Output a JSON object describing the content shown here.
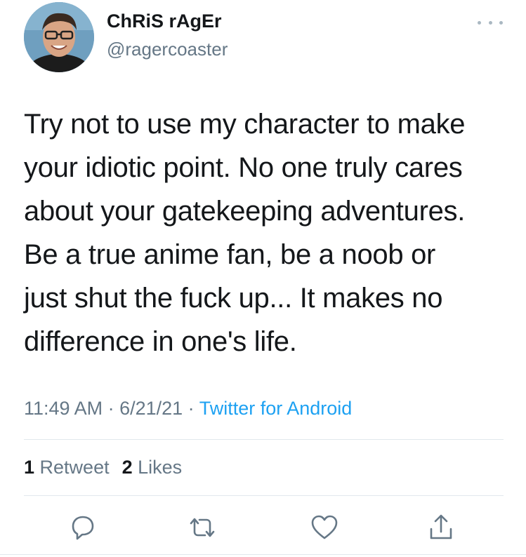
{
  "user": {
    "display_name": "ChRiS rAgEr",
    "handle": "@ragercoaster"
  },
  "tweet": {
    "text": "Try not to use my character to make\nyour idiotic point. No one truly cares\nabout your gatekeeping adventures.\nBe a true anime fan, be a noob or\njust shut the fuck up... It makes no\ndifference in one's life.",
    "time": "11:49 AM",
    "date": "6/21/21",
    "separator": " · ",
    "source": "Twitter for Android"
  },
  "stats": {
    "retweet_count": "1",
    "retweet_label": " Retweet",
    "like_count": "2",
    "like_label": " Likes"
  },
  "actions": [
    "reply-icon",
    "retweet-icon",
    "like-icon",
    "share-icon"
  ],
  "colors": {
    "muted": "#657786",
    "link": "#1da1f2",
    "icon": "#657786",
    "divider": "#e1e8ed"
  }
}
